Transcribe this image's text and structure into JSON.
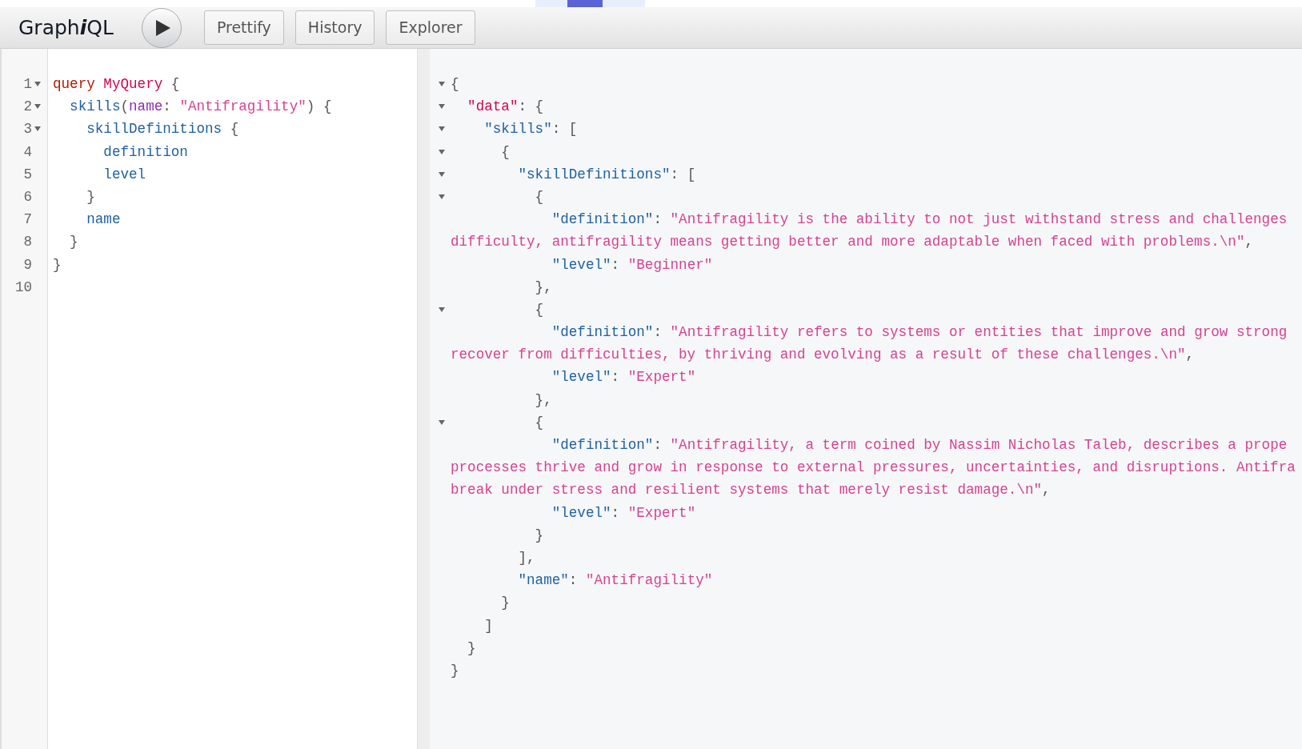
{
  "toolbar": {
    "title": [
      {
        "text": "Graph",
        "italic": false
      },
      {
        "text": "i",
        "italic": true
      },
      {
        "text": "QL",
        "italic": false
      }
    ],
    "buttons": [
      {
        "label": "Prettify"
      },
      {
        "label": "History"
      },
      {
        "label": "Explorer"
      }
    ]
  },
  "query_editor": {
    "lines": [
      {
        "number": "1",
        "foldable": true,
        "tokens": [
          {
            "text": "query ",
            "kind": "keyword"
          },
          {
            "text": "MyQuery",
            "kind": "def"
          },
          {
            "text": " {",
            "kind": "punctuation"
          }
        ]
      },
      {
        "number": "2",
        "foldable": true,
        "tokens": [
          {
            "text": "  skills",
            "kind": "property"
          },
          {
            "text": "(",
            "kind": "punctuation"
          },
          {
            "text": "name",
            "kind": "attribute"
          },
          {
            "text": ": ",
            "kind": "punctuation"
          },
          {
            "text": "\"Antifragility\"",
            "kind": "string"
          },
          {
            "text": ") {",
            "kind": "punctuation"
          }
        ]
      },
      {
        "number": "3",
        "foldable": true,
        "tokens": [
          {
            "text": "    skillDefinitions",
            "kind": "property"
          },
          {
            "text": " {",
            "kind": "punctuation"
          }
        ]
      },
      {
        "number": "4",
        "foldable": false,
        "tokens": [
          {
            "text": "      definition",
            "kind": "property"
          }
        ]
      },
      {
        "number": "5",
        "foldable": false,
        "tokens": [
          {
            "text": "      level",
            "kind": "property"
          }
        ]
      },
      {
        "number": "6",
        "foldable": false,
        "tokens": [
          {
            "text": "    }",
            "kind": "punctuation"
          }
        ]
      },
      {
        "number": "7",
        "foldable": false,
        "tokens": [
          {
            "text": "    name",
            "kind": "property"
          }
        ]
      },
      {
        "number": "8",
        "foldable": false,
        "tokens": [
          {
            "text": "  }",
            "kind": "punctuation"
          }
        ]
      },
      {
        "number": "9",
        "foldable": false,
        "tokens": [
          {
            "text": "}",
            "kind": "punctuation"
          }
        ]
      },
      {
        "number": "10",
        "foldable": false
      }
    ]
  },
  "result_viewer": {
    "lines": [
      {
        "foldable": true,
        "tokens": [
          {
            "text": "{",
            "kind": "punctuation"
          }
        ]
      },
      {
        "foldable": true,
        "tokens": [
          {
            "text": "  \"data\"",
            "kind": "def"
          },
          {
            "text": ": {",
            "kind": "punctuation"
          }
        ]
      },
      {
        "foldable": true,
        "tokens": [
          {
            "text": "    \"skills\"",
            "kind": "property"
          },
          {
            "text": ": [",
            "kind": "punctuation"
          }
        ]
      },
      {
        "foldable": true,
        "tokens": [
          {
            "text": "      {",
            "kind": "punctuation"
          }
        ]
      },
      {
        "foldable": true,
        "tokens": [
          {
            "text": "        \"skillDefinitions\"",
            "kind": "property"
          },
          {
            "text": ": [",
            "kind": "punctuation"
          }
        ]
      },
      {
        "foldable": true,
        "tokens": [
          {
            "text": "          {",
            "kind": "punctuation"
          }
        ]
      },
      {
        "foldable": false,
        "tokens": [
          {
            "text": "            \"definition\"",
            "kind": "property"
          },
          {
            "text": ": ",
            "kind": "punctuation"
          },
          {
            "text": "\"Antifragility is the ability to not just withstand stress and challenges",
            "kind": "string"
          }
        ]
      },
      {
        "foldable": false,
        "tokens": [
          {
            "text": "difficulty, antifragility means getting better and more adaptable when faced with problems.\\n\"",
            "kind": "string"
          },
          {
            "text": ",",
            "kind": "punctuation"
          }
        ]
      },
      {
        "foldable": false,
        "tokens": [
          {
            "text": "            \"level\"",
            "kind": "property"
          },
          {
            "text": ": ",
            "kind": "punctuation"
          },
          {
            "text": "\"Beginner\"",
            "kind": "string"
          }
        ]
      },
      {
        "foldable": false,
        "tokens": [
          {
            "text": "          },",
            "kind": "punctuation"
          }
        ]
      },
      {
        "foldable": true,
        "tokens": [
          {
            "text": "          {",
            "kind": "punctuation"
          }
        ]
      },
      {
        "foldable": false,
        "tokens": [
          {
            "text": "            \"definition\"",
            "kind": "property"
          },
          {
            "text": ": ",
            "kind": "punctuation"
          },
          {
            "text": "\"Antifragility refers to systems or entities that improve and grow strong",
            "kind": "string"
          }
        ]
      },
      {
        "foldable": false,
        "tokens": [
          {
            "text": "recover from difficulties, by thriving and evolving as a result of these challenges.\\n\"",
            "kind": "string"
          },
          {
            "text": ",",
            "kind": "punctuation"
          }
        ]
      },
      {
        "foldable": false,
        "tokens": [
          {
            "text": "            \"level\"",
            "kind": "property"
          },
          {
            "text": ": ",
            "kind": "punctuation"
          },
          {
            "text": "\"Expert\"",
            "kind": "string"
          }
        ]
      },
      {
        "foldable": false,
        "tokens": [
          {
            "text": "          },",
            "kind": "punctuation"
          }
        ]
      },
      {
        "foldable": true,
        "tokens": [
          {
            "text": "          {",
            "kind": "punctuation"
          }
        ]
      },
      {
        "foldable": false,
        "tokens": [
          {
            "text": "            \"definition\"",
            "kind": "property"
          },
          {
            "text": ": ",
            "kind": "punctuation"
          },
          {
            "text": "\"Antifragility, a term coined by Nassim Nicholas Taleb, describes a prope",
            "kind": "string"
          }
        ]
      },
      {
        "foldable": false,
        "tokens": [
          {
            "text": "processes thrive and grow in response to external pressures, uncertainties, and disruptions. Antifra",
            "kind": "string"
          }
        ]
      },
      {
        "foldable": false,
        "tokens": [
          {
            "text": "break under stress and resilient systems that merely resist damage.\\n\"",
            "kind": "string"
          },
          {
            "text": ",",
            "kind": "punctuation"
          }
        ]
      },
      {
        "foldable": false,
        "tokens": [
          {
            "text": "            \"level\"",
            "kind": "property"
          },
          {
            "text": ": ",
            "kind": "punctuation"
          },
          {
            "text": "\"Expert\"",
            "kind": "string"
          }
        ]
      },
      {
        "foldable": false,
        "tokens": [
          {
            "text": "          }",
            "kind": "punctuation"
          }
        ]
      },
      {
        "foldable": false,
        "tokens": [
          {
            "text": "        ],",
            "kind": "punctuation"
          }
        ]
      },
      {
        "foldable": false,
        "tokens": [
          {
            "text": "        \"name\"",
            "kind": "property"
          },
          {
            "text": ": ",
            "kind": "punctuation"
          },
          {
            "text": "\"Antifragility\"",
            "kind": "string"
          }
        ]
      },
      {
        "foldable": false,
        "tokens": [
          {
            "text": "      }",
            "kind": "punctuation"
          }
        ]
      },
      {
        "foldable": false,
        "tokens": [
          {
            "text": "    ]",
            "kind": "punctuation"
          }
        ]
      },
      {
        "foldable": false,
        "tokens": [
          {
            "text": "  }",
            "kind": "punctuation"
          }
        ]
      },
      {
        "foldable": false,
        "tokens": [
          {
            "text": "}",
            "kind": "punctuation"
          }
        ]
      }
    ]
  }
}
